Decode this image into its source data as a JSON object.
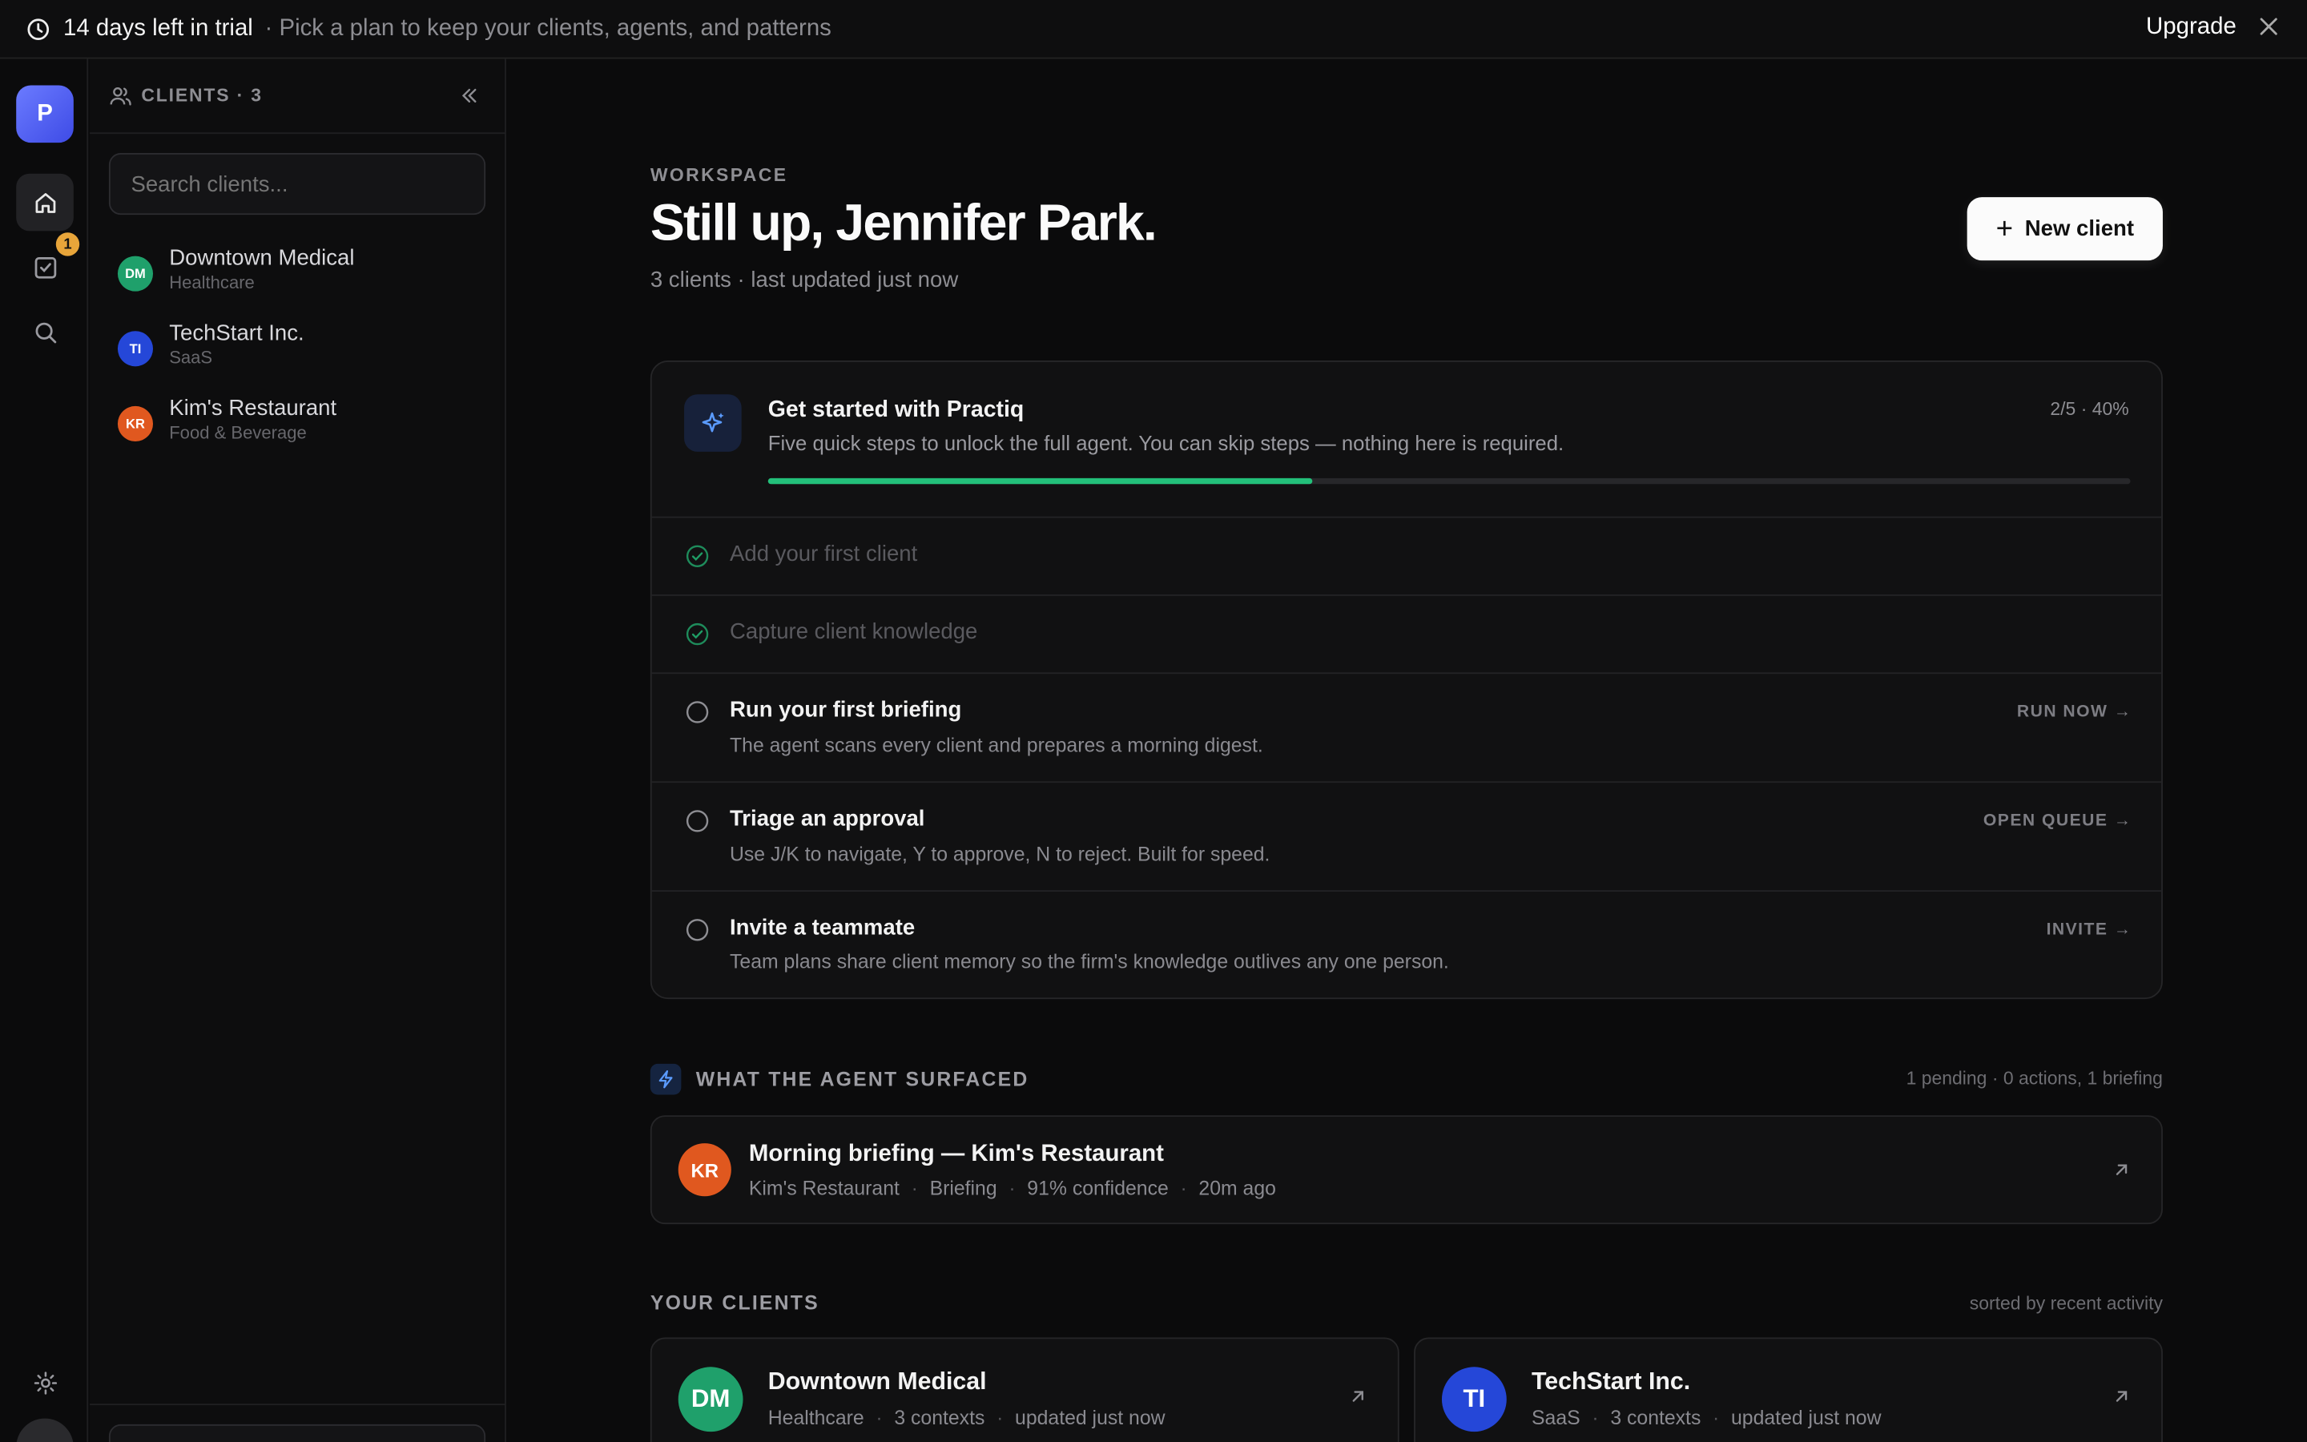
{
  "banner": {
    "trial": "14 days left in trial",
    "subtitle": "· Pick a plan to keep your clients, agents, and patterns",
    "upgrade": "Upgrade"
  },
  "rail": {
    "logo": "P",
    "approvals_badge": "1",
    "icons": [
      "home-icon",
      "check-square-icon",
      "search-icon",
      "gear-icon"
    ]
  },
  "clients_panel": {
    "header": "CLIENTS · 3",
    "search_placeholder": "Search clients...",
    "clients": [
      {
        "initials": "DM",
        "name": "Downtown Medical",
        "sector": "Healthcare",
        "color": "#1fa06b"
      },
      {
        "initials": "TI",
        "name": "TechStart Inc.",
        "sector": "SaaS",
        "color": "#2547d8"
      },
      {
        "initials": "KR",
        "name": "Kim's Restaurant",
        "sector": "Food & Beverage",
        "color": "#e0581f"
      }
    ]
  },
  "main": {
    "eyebrow": "WORKSPACE",
    "greeting": "Still up, Jennifer Park.",
    "meta": "3 clients · last updated just now",
    "new_client": "New client",
    "onboarding": {
      "title": "Get started with Practiq",
      "description": "Five quick steps to unlock the full agent. You can skip steps — nothing here is required.",
      "progress_label": "2/5 · 40%",
      "progress": 0.4,
      "steps": [
        {
          "title": "Add your first client",
          "done": true
        },
        {
          "title": "Capture client knowledge",
          "done": true
        },
        {
          "title": "Run your first briefing",
          "desc": "The agent scans every client and prepares a morning digest.",
          "action": "RUN NOW →",
          "done": false
        },
        {
          "title": "Triage an approval",
          "desc": "Use J/K to navigate, Y to approve, N to reject. Built for speed.",
          "action": "OPEN QUEUE →",
          "done": false
        },
        {
          "title": "Invite a teammate",
          "desc": "Team plans share client memory so the firm's knowledge outlives any one person.",
          "action": "INVITE →",
          "done": false
        }
      ]
    },
    "surfaced": {
      "title": "WHAT THE AGENT SURFACED",
      "meta": "1 pending · 0 actions, 1 briefing",
      "item": {
        "initials": "KR",
        "title": "Morning briefing — Kim's Restaurant",
        "client": "Kim's Restaurant",
        "type": "Briefing",
        "confidence": "91% confidence",
        "time": "20m ago"
      }
    },
    "your_clients": {
      "title": "YOUR CLIENTS",
      "meta": "sorted by recent activity",
      "cards": [
        {
          "initials": "DM",
          "name": "Downtown Medical",
          "sector": "Healthcare",
          "contexts": "3 contexts",
          "updated": "updated just now",
          "color": "#1fa06b"
        },
        {
          "initials": "TI",
          "name": "TechStart Inc.",
          "sector": "SaaS",
          "contexts": "3 contexts",
          "updated": "updated just now",
          "color": "#2547d8"
        }
      ]
    }
  }
}
